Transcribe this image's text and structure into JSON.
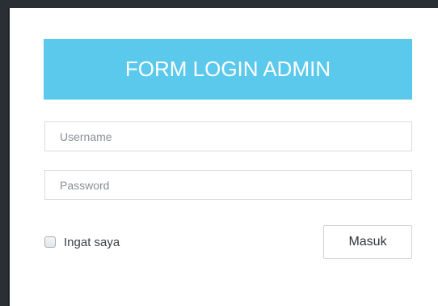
{
  "form": {
    "title": "FORM LOGIN ADMIN",
    "username_placeholder": "Username",
    "password_placeholder": "Password",
    "remember_label": "Ingat saya",
    "submit_label": "Masuk"
  },
  "colors": {
    "header_bg": "#5bc9ec",
    "header_text": "#ffffff",
    "panel_bg": "#ffffff"
  }
}
